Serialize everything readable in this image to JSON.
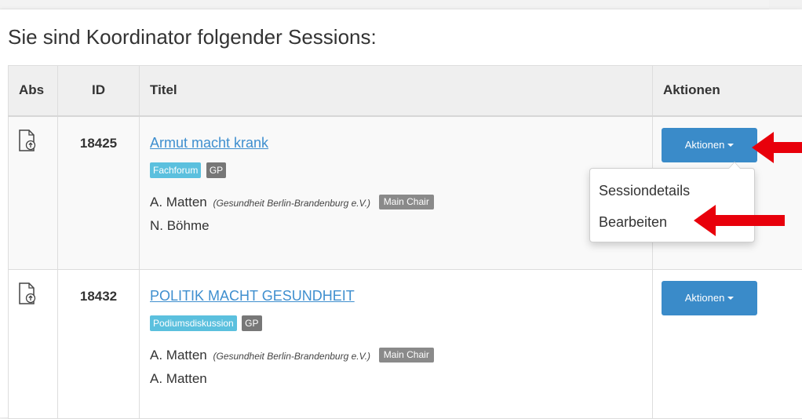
{
  "heading": "Sie sind Koordinator folgender Sessions:",
  "table": {
    "headers": {
      "abs": "Abs",
      "id": "ID",
      "titel": "Titel",
      "aktionen": "Aktionen"
    },
    "rows": [
      {
        "id": "18425",
        "title": "Armut macht krank",
        "tags": [
          "Fachforum",
          "GP"
        ],
        "chair_name": "A. Matten",
        "chair_org": "(Gesundheit Berlin-Brandenburg e.V.)",
        "chair_role": "Main Chair",
        "person2": "N. Böhme",
        "action_label": "Aktionen"
      },
      {
        "id": "18432",
        "title": "POLITIK MACHT GESUNDHEIT",
        "tags": [
          "Podiumsdiskussion",
          "GP"
        ],
        "chair_name": "A. Matten",
        "chair_org": "(Gesundheit Berlin-Brandenburg e.V.)",
        "chair_role": "Main Chair",
        "person2": "A. Matten",
        "action_label": "Aktionen"
      }
    ]
  },
  "dropdown": {
    "items": [
      "Sessiondetails",
      "Bearbeiten"
    ]
  },
  "colors": {
    "link": "#3f8fcf",
    "button": "#3a8bc9",
    "tag_blue": "#5bc0de",
    "tag_gray": "#777777",
    "arrow": "#e8000b"
  },
  "icons": {
    "abs": "file-upload-icon",
    "annotation": "red-arrow-icon"
  }
}
